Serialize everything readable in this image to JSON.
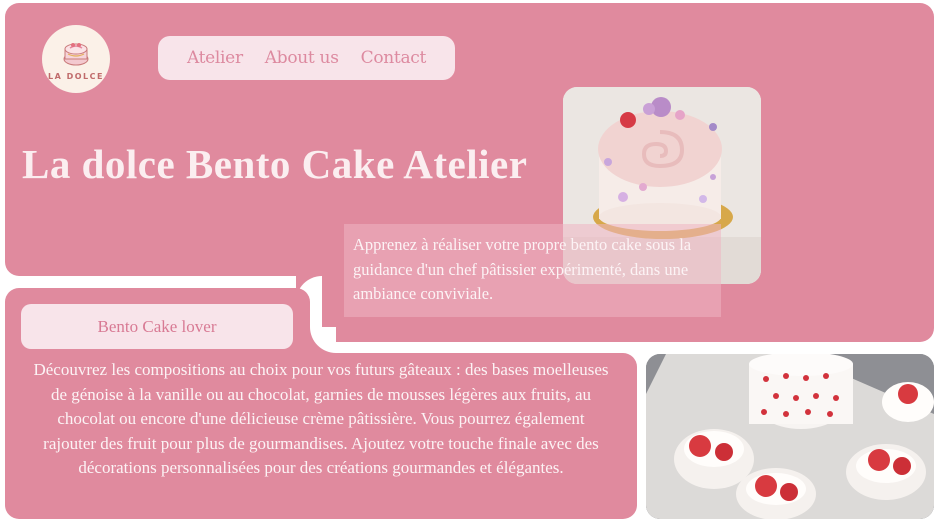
{
  "brand": {
    "logo_text": "LA DOLCE"
  },
  "nav": {
    "items": [
      "Atelier",
      "About us",
      "Contact"
    ]
  },
  "hero": {
    "title": "La dolce Bento Cake Atelier",
    "description": "Apprenez à réaliser votre propre bento cake sous la guidance d'un chef pâtissier expérimenté, dans une ambiance conviviale."
  },
  "card": {
    "button_label": "Bento Cake lover",
    "text": "Découvrez les compositions au choix pour vos futurs gâteaux : des bases moelleuses de génoise à la vanille ou au chocolat, garnies de mousses légères aux fruits, au chocolat ou encore d'une délicieuse crème pâtissière. Vous pourrez également rajouter des fruit pour plus de gourmandises. Ajoutez votre touche finale avec des décorations personnalisées pour des créations gourmandes et élégantes."
  },
  "colors": {
    "panel": "#e08a9e",
    "nav_bg": "#f8e4ea",
    "nav_text": "#dd8aa0",
    "title_text": "#fbeef0"
  },
  "images": {
    "top": "bento-cake-photo",
    "bottom": "cakes-and-cupcakes-photo"
  }
}
